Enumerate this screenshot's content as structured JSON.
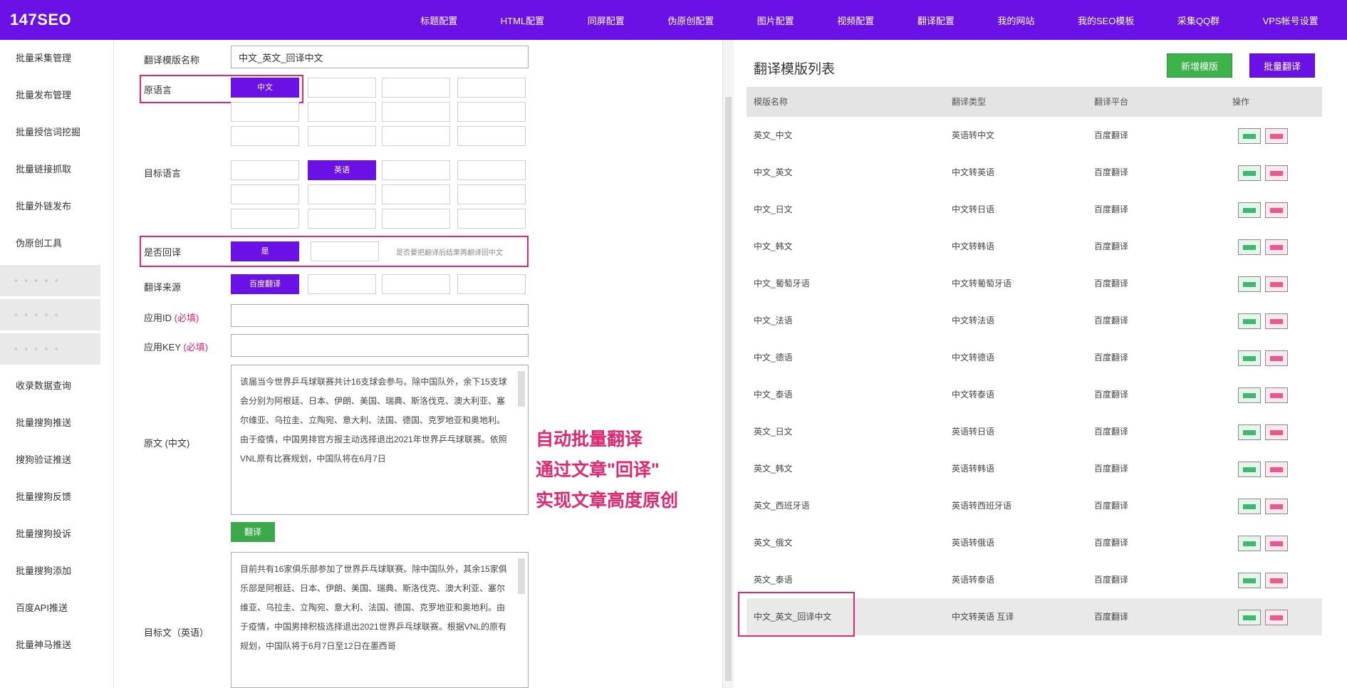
{
  "brand": "147SEO",
  "nav": [
    "标题配置",
    "HTML配置",
    "同屏配置",
    "伪原创配置",
    "图片配置",
    "视频配置",
    "翻译配置",
    "我的网站",
    "我的SEO模板",
    "采集QQ群",
    "VPS帐号设置"
  ],
  "sidebar": [
    "批量采集管理",
    "批量发布管理",
    "批量授信词挖掘",
    "批量链接抓取",
    "批量外链发布",
    "伪原创工具",
    "",
    "",
    "",
    "收录数据查询",
    "批量搜狗推送",
    "搜狗验证推送",
    "批量搜狗反馈",
    "批量搜狗投诉",
    "批量搜狗添加",
    "百度API推送",
    "批量神马推送"
  ],
  "form": {
    "name_label": "翻译模版名称",
    "name_value": "中文_英文_回译中文",
    "source_label": "原语言",
    "source_selected": "中文",
    "target_label": "目标语言",
    "target_selected": "英语",
    "back_label": "是否回译",
    "back_selected": "是",
    "back_note": "是否要把翻译后结果再翻译回中文",
    "engine_label": "翻译来源",
    "engine_selected": "百度翻译",
    "appid_label": "应用ID",
    "appid_hint": "(必填)",
    "appkey_label": "应用KEY",
    "appkey_hint": "(必填)",
    "original_label": "原文",
    "original_hint": "(中文)",
    "original_text": "该届当今世界乒乓球联赛共计16支球会参与。除中国队外，余下15支球会分别为阿根廷、日本、伊朗、美国、瑞典、斯洛伐克、澳大利亚、塞尔维亚、乌拉圭、立陶宛、意大利、法国、德国、克罗地亚和奥地利。由于疫情，中国男排官方报主动选择退出2021年世界乒乓球联赛。依照VNL原有比赛规划，中国队将在6月7日",
    "translate_btn": "翻译",
    "target_text_label": "目标文（英语）",
    "target_text": "目前共有16家俱乐部参加了世界乒乓球联赛。除中国队外，其余15家俱乐部是阿根廷、日本、伊朗、美国、瑞典、斯洛伐克、澳大利亚、塞尔维亚、乌拉圭、立陶宛、意大利、法国、德国、克罗地亚和奥地利。由于疫情，中国男排积极选择退出2021世界乒乓球联赛。根据VNL的原有规划，中国队将于6月7日至12日在墨西哥"
  },
  "annotation": [
    "自动批量翻译",
    "通过文章\"回译\"",
    "实现文章高度原创"
  ],
  "list": {
    "title": "翻译模版列表",
    "add_btn": "新增模版",
    "batch_btn": "批量翻译",
    "columns": [
      "模版名称",
      "翻译类型",
      "翻译平台",
      "操作"
    ],
    "rows": [
      [
        "英文_中文",
        "英语转中文",
        "百度翻译"
      ],
      [
        "中文_英文",
        "中文转英语",
        "百度翻译"
      ],
      [
        "中文_日文",
        "中文转日语",
        "百度翻译"
      ],
      [
        "中文_韩文",
        "中文转韩语",
        "百度翻译"
      ],
      [
        "中文_葡萄牙语",
        "中文转葡萄牙语",
        "百度翻译"
      ],
      [
        "中文_法语",
        "中文转法语",
        "百度翻译"
      ],
      [
        "中文_德语",
        "中文转德语",
        "百度翻译"
      ],
      [
        "中文_泰语",
        "中文转泰语",
        "百度翻译"
      ],
      [
        "英文_日文",
        "英语转日语",
        "百度翻译"
      ],
      [
        "英文_韩文",
        "英语转韩语",
        "百度翻译"
      ],
      [
        "英文_西班牙语",
        "英语转西班牙语",
        "百度翻译"
      ],
      [
        "英文_俄文",
        "英语转俄语",
        "百度翻译"
      ],
      [
        "英文_泰语",
        "英语转泰语",
        "百度翻译"
      ],
      [
        "中文_英文_回译中文",
        "中文转英语 互译",
        "百度翻译"
      ]
    ],
    "edit_label": "编辑",
    "delete_label": "删除"
  },
  "colors": {
    "accent": "#6a11e6",
    "highlight": "#e0276f",
    "green": "#3cb44b"
  }
}
